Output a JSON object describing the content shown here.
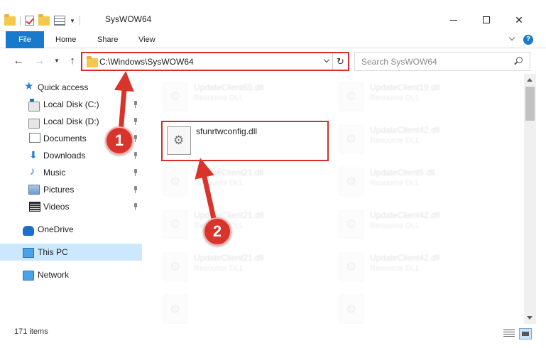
{
  "window": {
    "title": "SysWOW64"
  },
  "ribbon": {
    "tabs": [
      "File",
      "Home",
      "Share",
      "View"
    ]
  },
  "address": {
    "path": "C:\\Windows\\SysWOW64",
    "search_placeholder": "Search SysWOW64"
  },
  "sidebar": {
    "items": [
      {
        "label": "Quick access",
        "icon": "star-icon"
      },
      {
        "label": "Local Disk (C:)",
        "icon": "disk-icon"
      },
      {
        "label": "Local Disk (D:)",
        "icon": "disk-icon"
      },
      {
        "label": "Documents",
        "icon": "documents-icon"
      },
      {
        "label": "Downloads",
        "icon": "downloads-icon"
      },
      {
        "label": "Music",
        "icon": "music-icon"
      },
      {
        "label": "Pictures",
        "icon": "pictures-icon"
      },
      {
        "label": "Videos",
        "icon": "videos-icon"
      },
      {
        "label": "OneDrive",
        "icon": "onedrive-icon"
      },
      {
        "label": "This PC",
        "icon": "this-pc-icon"
      },
      {
        "label": "Network",
        "icon": "network-icon"
      }
    ]
  },
  "files": {
    "left": [
      {
        "name": "UpdateClient65.dll",
        "type": "Resource DLL"
      },
      {
        "name": "UpdateClient21.dll",
        "type": "Resource DLL"
      },
      {
        "name": "UpdateClient21.dll",
        "type": "Resource DLL"
      },
      {
        "name": "UpdateClient21.dll",
        "type": "Resource DLL"
      },
      {
        "name": "",
        "type": ""
      }
    ],
    "right": [
      {
        "name": "UpdateClient19.dll",
        "type": "Resource DLL"
      },
      {
        "name": "UpdateClient42.dll",
        "type": "Resource DLL"
      },
      {
        "name": "UpdateClient5.dll",
        "type": "Resource DLL"
      },
      {
        "name": "UpdateClient42.dll",
        "type": "Resource DLL"
      },
      {
        "name": "UpdateClient42.dll",
        "type": "Resource DLL"
      },
      {
        "name": "",
        "type": ""
      }
    ],
    "highlighted": {
      "name": "sfunrtwconfig.dll"
    }
  },
  "annotations": {
    "step1": "1",
    "step2": "2"
  },
  "status": {
    "items_count": "171 items"
  },
  "colors": {
    "accent": "#1979ca",
    "highlight_red": "#d62d2d",
    "selection": "#cce8ff"
  }
}
